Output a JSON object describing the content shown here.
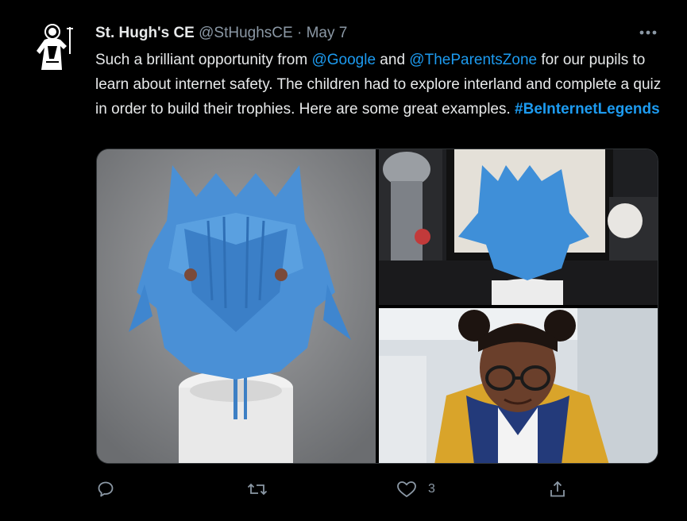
{
  "tweet": {
    "author_name": "St. Hugh's CE",
    "handle": "@StHughsCE",
    "separator": "·",
    "date": "May 7",
    "text_1": "Such a brilliant opportunity from ",
    "mention_1": "@Google",
    "text_2": " and ",
    "mention_2": "@TheParentsZone",
    "text_3": " for our pupils to learn about internet safety.  The children had to explore interland and complete a quiz in order to build their trophies.   Here are some great examples. ",
    "hashtag": "#BeInternetLegends",
    "like_count": "3"
  },
  "icons": {
    "more": "more-dots-icon",
    "reply": "reply-icon",
    "retweet": "retweet-icon",
    "like": "like-icon",
    "share": "share-icon"
  },
  "colors": {
    "background": "#000000",
    "text": "#e7e9ea",
    "secondary": "#8b98a5",
    "link": "#1d9bf0"
  }
}
